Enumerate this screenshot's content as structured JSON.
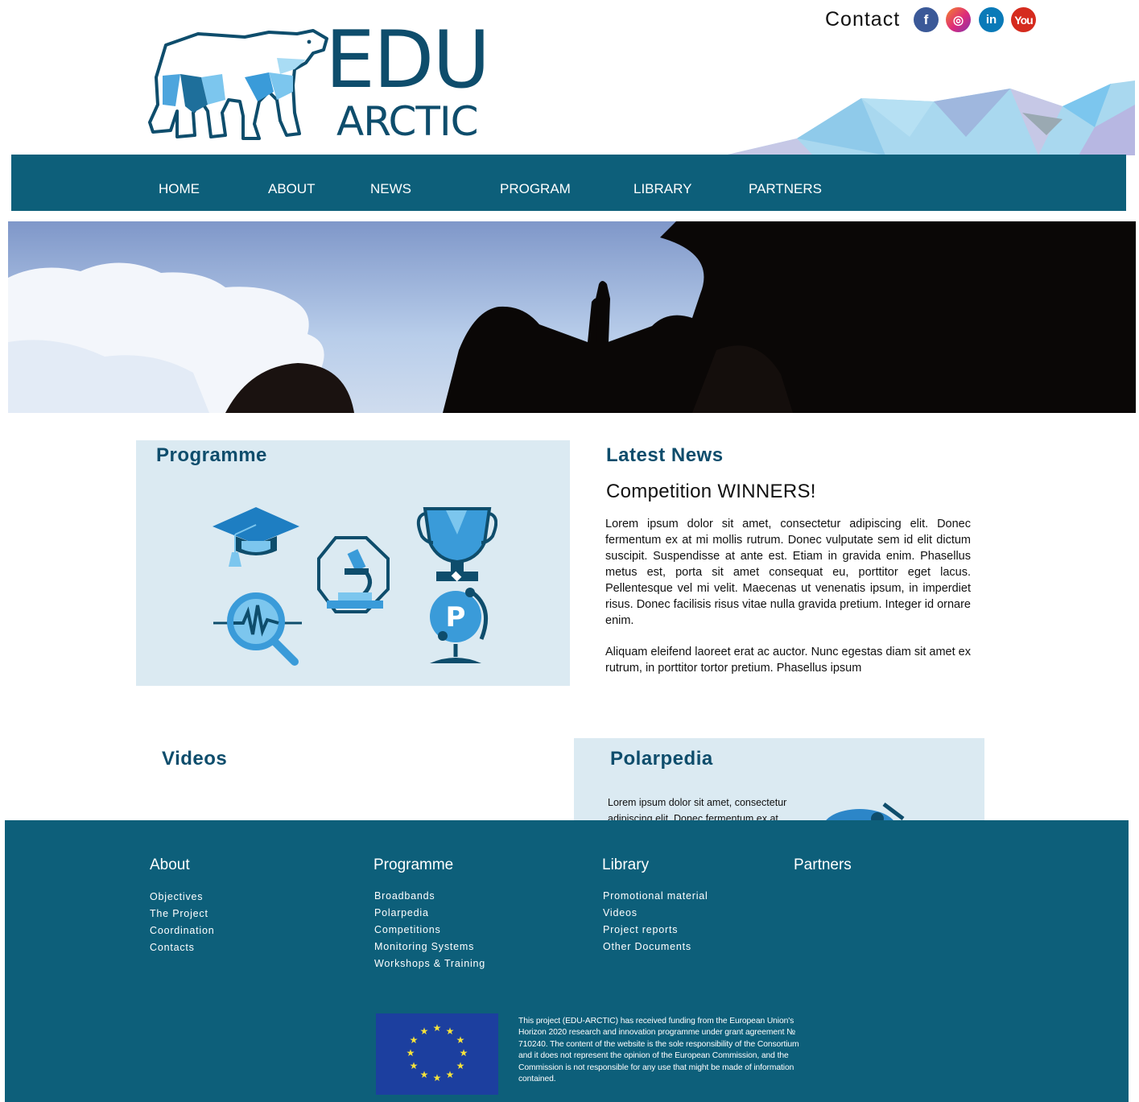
{
  "header": {
    "logo": {
      "line1": "EDU",
      "line2": "ARCTIC"
    },
    "contact_label": "Contact",
    "social": [
      {
        "name": "facebook",
        "glyph": "f",
        "color": "#3b5998"
      },
      {
        "name": "instagram",
        "glyph": "◎",
        "color": "#dd2a7b"
      },
      {
        "name": "linkedin",
        "glyph": "in",
        "color": "#0a7ab8"
      },
      {
        "name": "youtube",
        "glyph": "You",
        "color": "#d52b1e"
      }
    ]
  },
  "nav": {
    "items": [
      {
        "label": "HOME"
      },
      {
        "label": "ABOUT"
      },
      {
        "label": "NEWS"
      },
      {
        "label": "PROGRAM"
      },
      {
        "label": "LIBRARY"
      },
      {
        "label": "PARTNERS"
      }
    ]
  },
  "programme": {
    "title": "Programme"
  },
  "news": {
    "title": "Latest News",
    "headline": "Competition WINNERS!",
    "paragraphs": [
      "Lorem ipsum dolor sit amet, consectetur adipiscing elit. Donec fermentum ex at mi mollis rutrum. Donec vulputate sem id elit dictum suscipit. Suspendisse at ante est. Etiam in gravida enim. Phasellus metus est, porta sit amet consequat eu, porttitor eget lacus. Pellentesque vel mi velit. Maecenas ut venenatis ipsum, in imperdiet risus. Donec facilisis risus vitae nulla gravida pretium. Integer id ornare enim.",
      "Aliquam eleifend laoreet erat ac auctor. Nunc egestas diam sit amet ex rutrum, in porttitor tortor pretium. Phasellus ipsum"
    ]
  },
  "videos": {
    "title": "Videos"
  },
  "polarpedia": {
    "title": "Polarpedia",
    "text": "Lorem ipsum dolor sit amet, consectetur adipiscing elit. Donec fermentum ex at"
  },
  "footer": {
    "columns": [
      {
        "heading": "About",
        "links": [
          "Objectives",
          "The Project",
          "Coordination",
          "Contacts"
        ]
      },
      {
        "heading": "Programme",
        "links": [
          "Broadbands",
          "Polarpedia",
          "Competitions",
          "Monitoring Systems",
          "Workshops & Training"
        ]
      },
      {
        "heading": "Library",
        "links": [
          "Promotional material",
          "Videos",
          "Project reports",
          "Other Documents"
        ]
      },
      {
        "heading": "Partners",
        "links": []
      }
    ],
    "funding_text": "This project (EDU-ARCTIC) has received funding from the European Union's Horizon 2020 research and innovation programme under grant agreement № 710240. The content of the website is the sole responsibility of the Consortium and it does not represent the opinion of the European Commission, and the Commission is not responsible for any use that might be made of information contained."
  },
  "colors": {
    "brand_dark": "#0e4d6c",
    "nav_bg": "#0d5f7a",
    "card_bg": "#dbeaf2",
    "icon_blue": "#3a9bd9"
  }
}
